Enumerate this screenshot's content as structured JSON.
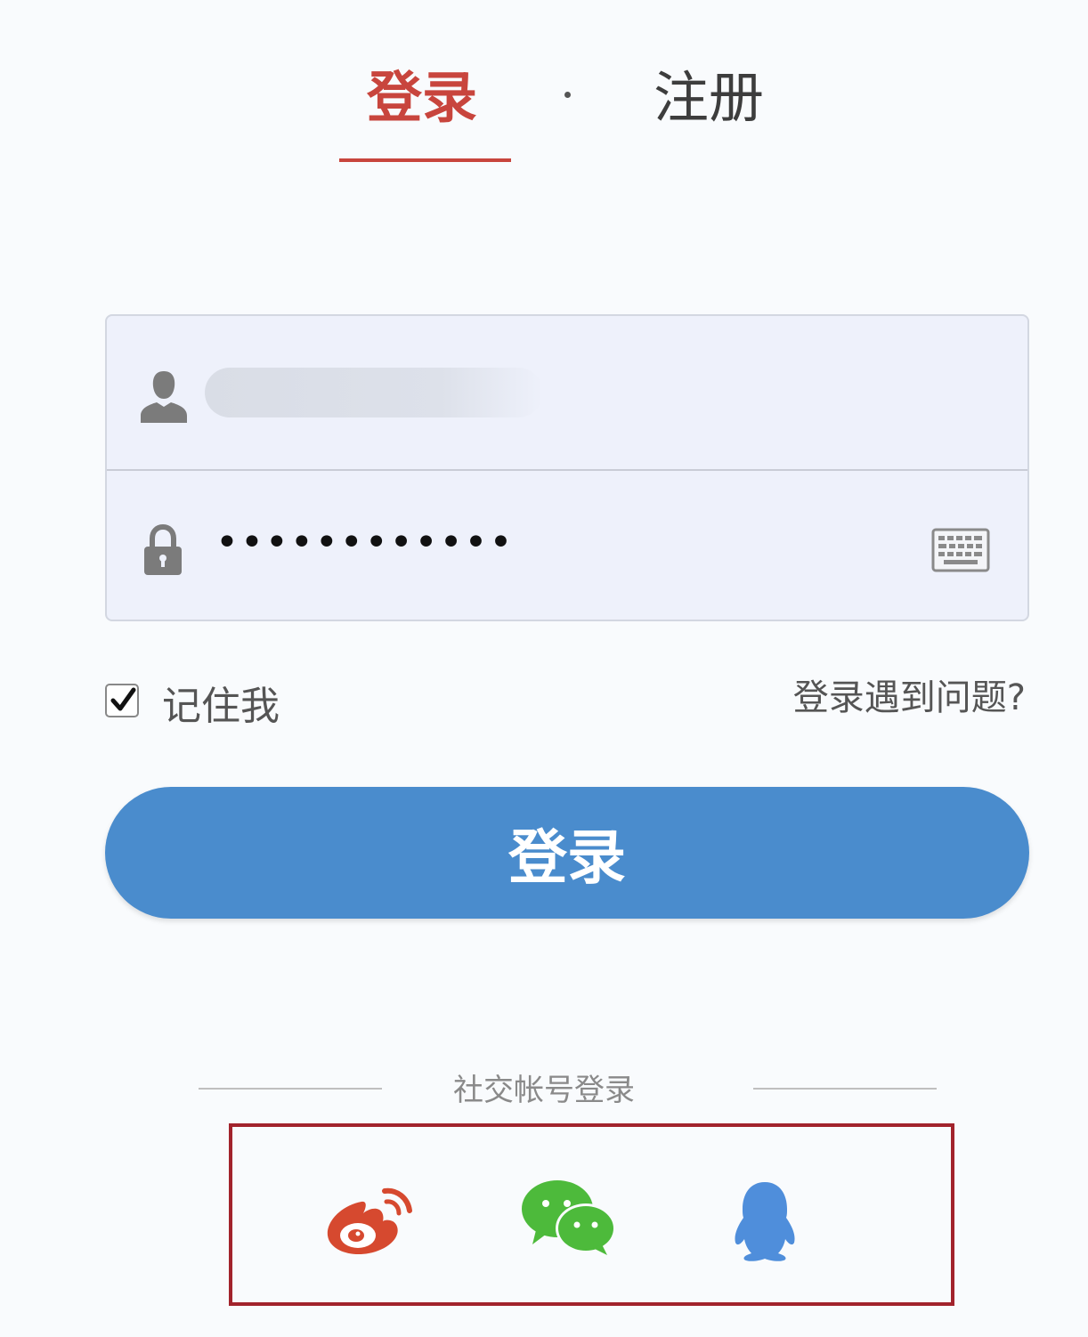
{
  "tabs": {
    "login": "登录",
    "register": "注册"
  },
  "form": {
    "username_value": "",
    "password_value": "••••••••••••"
  },
  "options": {
    "remember_label": "记住我",
    "remember_checked": true,
    "trouble_link": "登录遇到问题?"
  },
  "login_button": "登录",
  "social": {
    "title": "社交帐号登录",
    "providers": [
      "weibo",
      "wechat",
      "qq"
    ]
  },
  "icons": [
    "user-icon",
    "lock-icon",
    "keyboard-icon",
    "check-icon",
    "weibo-icon",
    "wechat-icon",
    "qq-icon"
  ],
  "colors": {
    "accent_red": "#c8453d",
    "button_blue": "#4a8ccd",
    "frame_red": "#a2232c",
    "field_bg": "#eef1fb"
  }
}
